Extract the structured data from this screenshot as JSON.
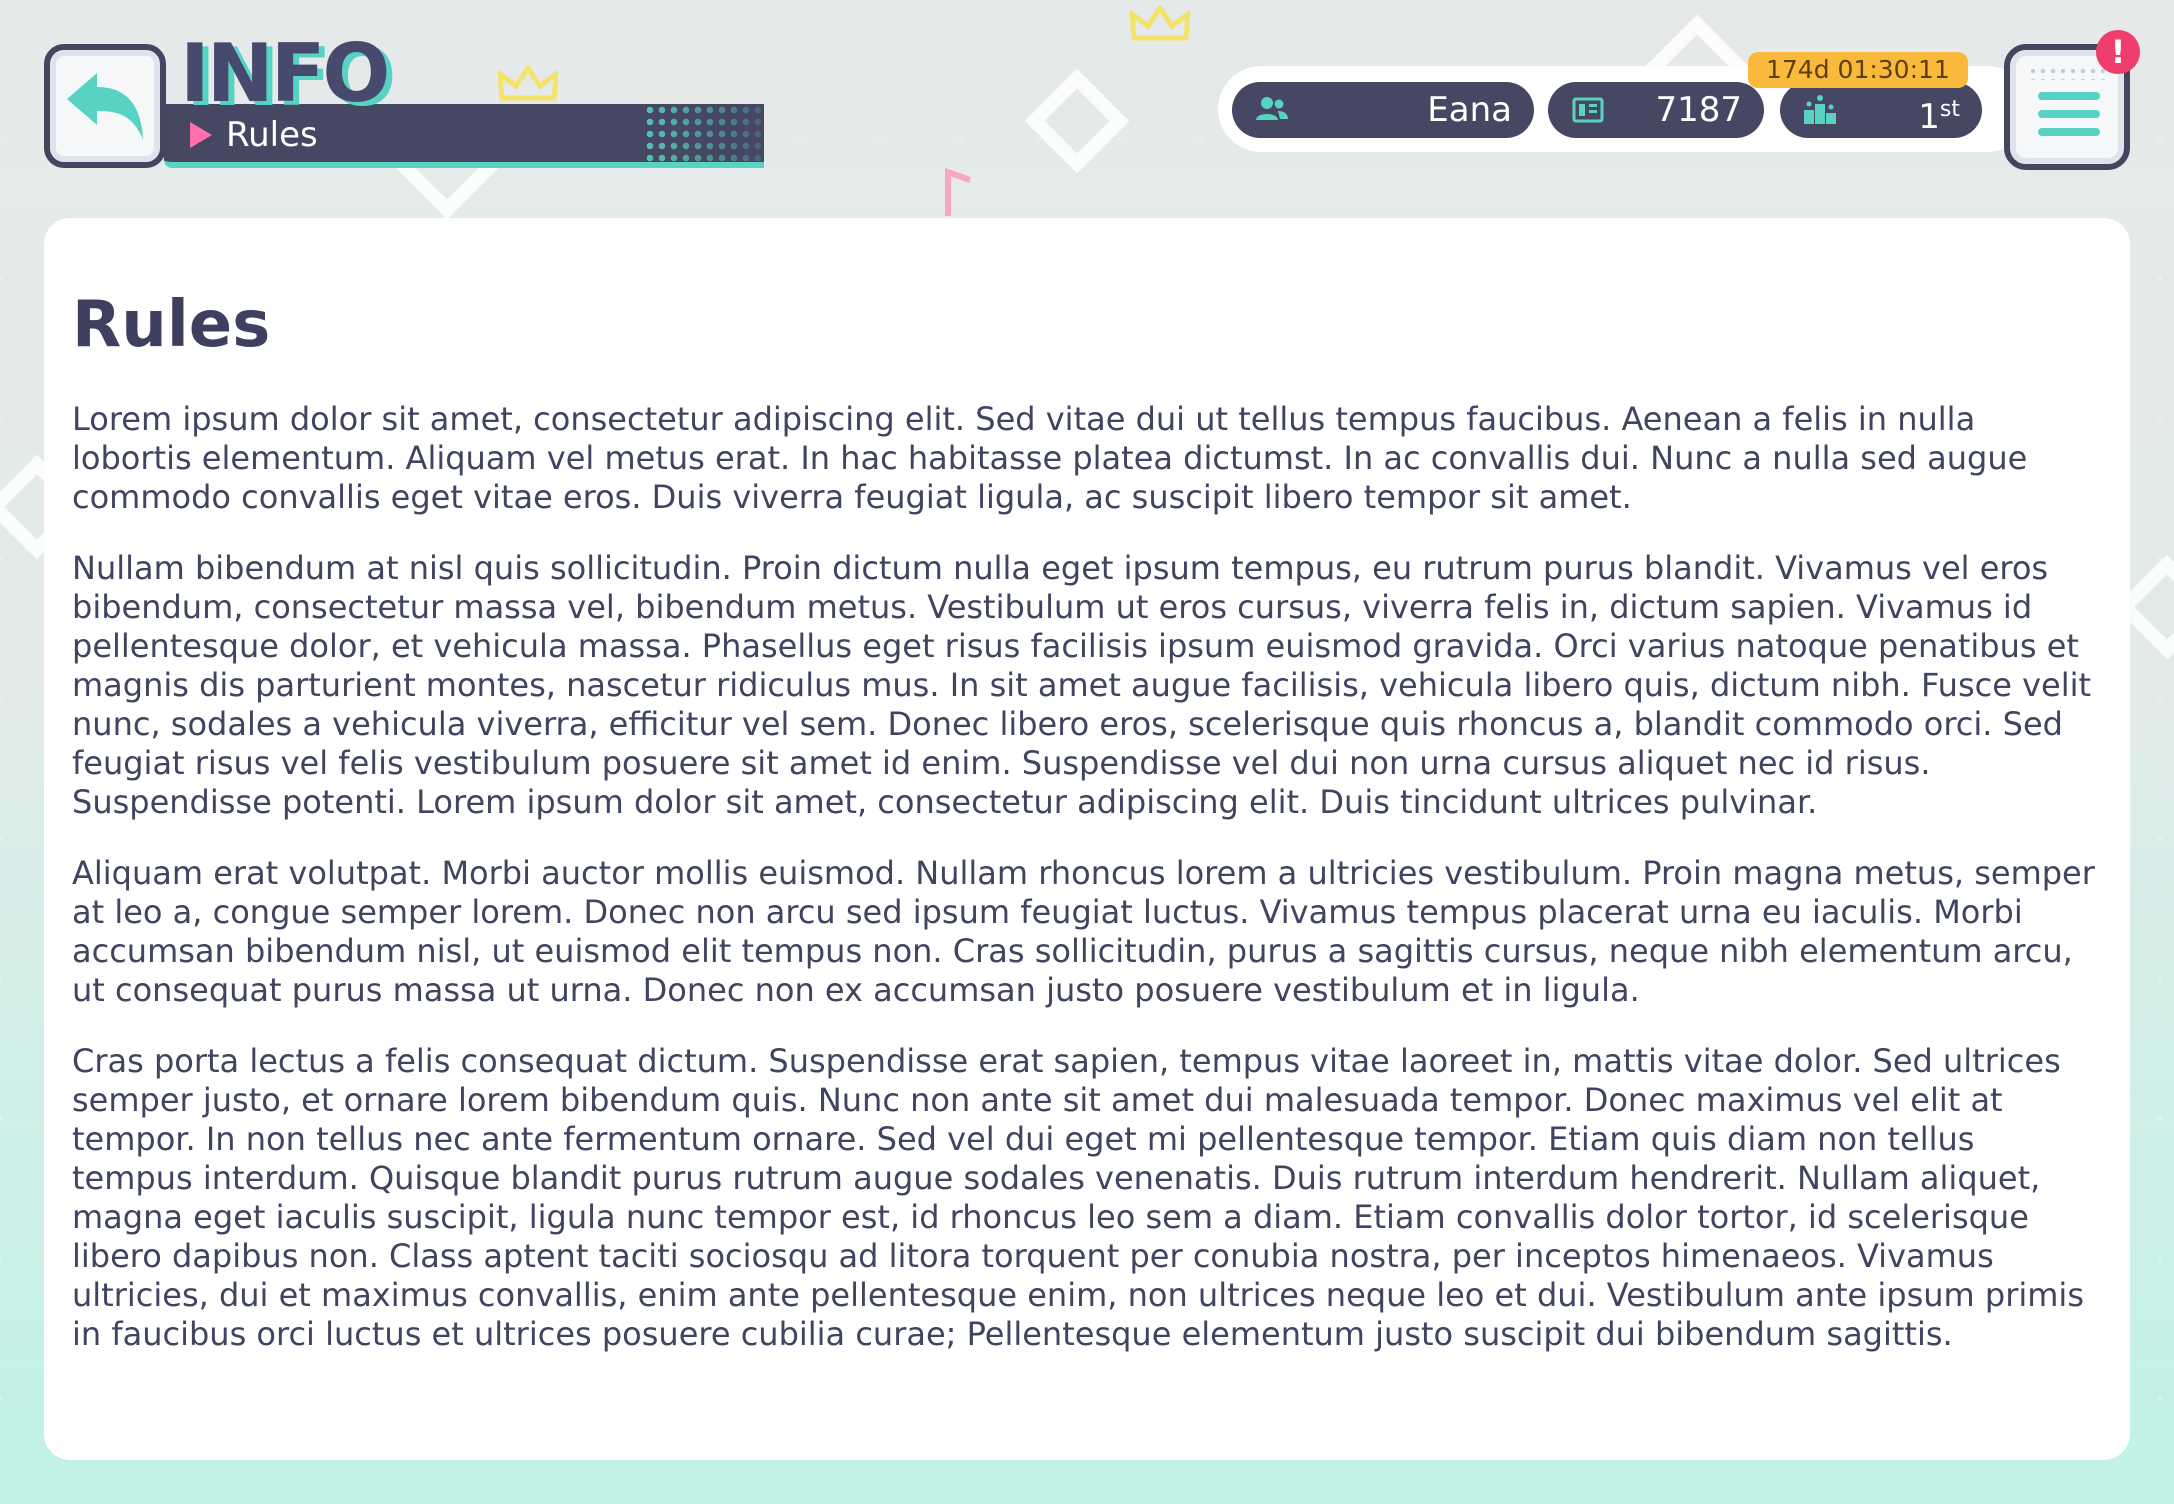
{
  "header": {
    "section_title": "INFO",
    "page_label": "Rules"
  },
  "status": {
    "username": "Eana",
    "points": "7187",
    "rank_number": "1",
    "rank_suffix": "st",
    "event_timer": "174d 01:30:11",
    "menu_alert": "!"
  },
  "icons": {
    "back": "back-arrow-icon",
    "user": "user-icon",
    "points": "points-card-icon",
    "rank": "ranking-podium-icon",
    "menu": "hamburger-menu-icon",
    "alert": "exclamation-icon"
  },
  "colors": {
    "accent": "#58d3c3",
    "navy": "#464863",
    "pink": "#ff6fae",
    "timer": "#f9b93d",
    "alert": "#ef3d6c"
  },
  "content": {
    "heading": "Rules",
    "paragraphs": [
      "Lorem ipsum dolor sit amet, consectetur adipiscing elit. Sed vitae dui ut tellus tempus faucibus. Aenean a felis in nulla lobortis elementum. Aliquam vel metus erat. In hac habitasse platea dictumst. In ac convallis dui. Nunc a nulla sed augue commodo convallis eget vitae eros. Duis viverra feugiat ligula, ac suscipit libero tempor sit amet.",
      "Nullam bibendum at nisl quis sollicitudin. Proin dictum nulla eget ipsum tempus, eu rutrum purus blandit. Vivamus vel eros bibendum, consectetur massa vel, bibendum metus. Vestibulum ut eros cursus, viverra felis in, dictum sapien. Vivamus id pellentesque dolor, et vehicula massa. Phasellus eget risus facilisis ipsum euismod gravida. Orci varius natoque penatibus et magnis dis parturient montes, nascetur ridiculus mus. In sit amet augue facilisis, vehicula libero quis, dictum nibh. Fusce velit nunc, sodales a vehicula viverra, efficitur vel sem. Donec libero eros, scelerisque quis rhoncus a, blandit commodo orci. Sed feugiat risus vel felis vestibulum posuere sit amet id enim. Suspendisse vel dui non urna cursus aliquet nec id risus. Suspendisse potenti. Lorem ipsum dolor sit amet, consectetur adipiscing elit. Duis tincidunt ultrices pulvinar.",
      "Aliquam erat volutpat. Morbi auctor mollis euismod. Nullam rhoncus lorem a ultricies vestibulum. Proin magna metus, semper at leo a, congue semper lorem. Donec non arcu sed ipsum feugiat luctus. Vivamus tempus placerat urna eu iaculis. Morbi accumsan bibendum nisl, ut euismod elit tempus non. Cras sollicitudin, purus a sagittis cursus, neque nibh elementum arcu, ut consequat purus massa ut urna. Donec non ex accumsan justo posuere vestibulum et in ligula.",
      "Cras porta lectus a felis consequat dictum. Suspendisse erat sapien, tempus vitae laoreet in, mattis vitae dolor. Sed ultrices semper justo, et ornare lorem bibendum quis. Nunc non ante sit amet dui malesuada tempor. Donec maximus vel elit at tempor. In non tellus nec ante fermentum ornare. Sed vel dui eget mi pellentesque tempor. Etiam quis diam non tellus tempus interdum. Quisque blandit purus rutrum augue sodales venenatis. Duis rutrum interdum hendrerit. Nullam aliquet, magna eget iaculis suscipit, ligula nunc tempor est, id rhoncus leo sem a diam. Etiam convallis dolor tortor, id scelerisque libero dapibus non. Class aptent taciti sociosqu ad litora torquent per conubia nostra, per inceptos himenaeos. Vivamus ultricies, dui et maximus convallis, enim ante pellentesque enim, non ultrices neque leo et dui. Vestibulum ante ipsum primis in faucibus orci luctus et ultrices posuere cubilia curae; Pellentesque elementum justo suscipit dui bibendum sagittis."
    ]
  }
}
